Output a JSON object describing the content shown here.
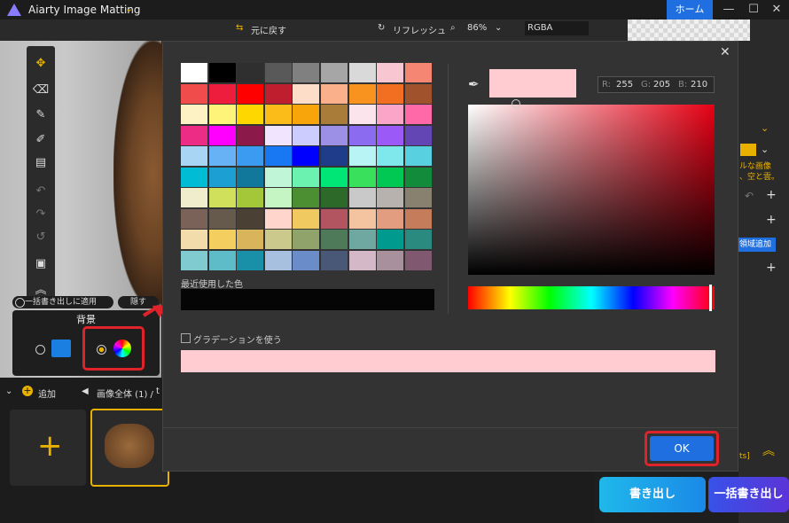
{
  "titlebar": {
    "app_title": "Aiarty Image Matting",
    "home_label": "ホーム",
    "minimize": "—",
    "maximize": "☐",
    "close": "✕"
  },
  "toolbar": {
    "undo_label": "元に戻す",
    "refresh_label": "リフレッシュ",
    "zoom_value": "86%",
    "rgba_label": "RGBA"
  },
  "canvas": {
    "apply_all_label": "一括書き出しに適用",
    "hide_label": "隠す",
    "background_title": "背景"
  },
  "bottom": {
    "add_label": "追加",
    "breadcrumb": "画像全体 (1) /",
    "breadcrumb_extra": "t"
  },
  "right_panel": {
    "snippet1": "ルな画像",
    "snippet2": "、空と雲。",
    "region_add_label": "領域追加",
    "snippet_bits": "ts]"
  },
  "actions": {
    "export_label": "書き出し",
    "batch_export_label": "一括書き出し"
  },
  "dialog": {
    "recent_label": "最近使用した色",
    "gradient_label": "グラデーションを使う",
    "ok_label": "OK",
    "rgb": {
      "r_label": "R:",
      "r": "255",
      "g_label": "G:",
      "g": "205",
      "b_label": "B:",
      "b": "210"
    },
    "selected_color": "#ffccd2",
    "palette": [
      [
        "#ffffff",
        "#000000",
        "#2f2f2f",
        "#595959",
        "#808080",
        "#a6a6a6",
        "#d9d9d9",
        "#f7c6d1",
        "#f58674"
      ],
      [
        "#f14c4c",
        "#ee1c3d",
        "#ff0000",
        "#be1e2d",
        "#fddcc8",
        "#fbb08c",
        "#f7931e",
        "#f26f21",
        "#a0522d"
      ],
      [
        "#fdf2c3",
        "#fff47a",
        "#ffd700",
        "#fbbc1a",
        "#f7a50a",
        "#a97c39",
        "#fce4ec",
        "#fba6c8",
        "#ff69a8"
      ],
      [
        "#ed2c86",
        "#ff00ff",
        "#8b1a4b",
        "#f1e4ff",
        "#ccccff",
        "#9b8fe6",
        "#8b6cf0",
        "#9b59f7",
        "#6445b4"
      ],
      [
        "#a9d5f5",
        "#66b2f5",
        "#3b9bf0",
        "#1877f2",
        "#0000ff",
        "#1e3c8a",
        "#b8f4f5",
        "#7ee8ed",
        "#58d0e0"
      ],
      [
        "#00bcd4",
        "#1c9fd3",
        "#12789b",
        "#c0f5d8",
        "#6bf2b1",
        "#00e676",
        "#38e05c",
        "#00c853",
        "#128c3a"
      ],
      [
        "#efedcc",
        "#d0e05a",
        "#a4c639",
        "#c5f5c2",
        "#4c8f32",
        "#2d6a2a",
        "#c9c9c9",
        "#b7b2ae",
        "#898170"
      ],
      [
        "#7a6258",
        "#665a4d",
        "#4a4034",
        "#ffd5cc",
        "#f0c960",
        "#b35560",
        "#f4c4a0",
        "#e29c80",
        "#c47c5a"
      ],
      [
        "#f2dcab",
        "#f4ce5e",
        "#d9b45a",
        "#ccc98c",
        "#8fa36b",
        "#4f7a5a",
        "#6fa8a0",
        "#009a8e",
        "#2b8a80"
      ],
      [
        "#7fcbd0",
        "#5ebcc8",
        "#1a8fa8",
        "#a8c0e0",
        "#6a8cc8",
        "#4a5878",
        "#d4b8c8",
        "#a8909c",
        "#805870"
      ]
    ]
  }
}
